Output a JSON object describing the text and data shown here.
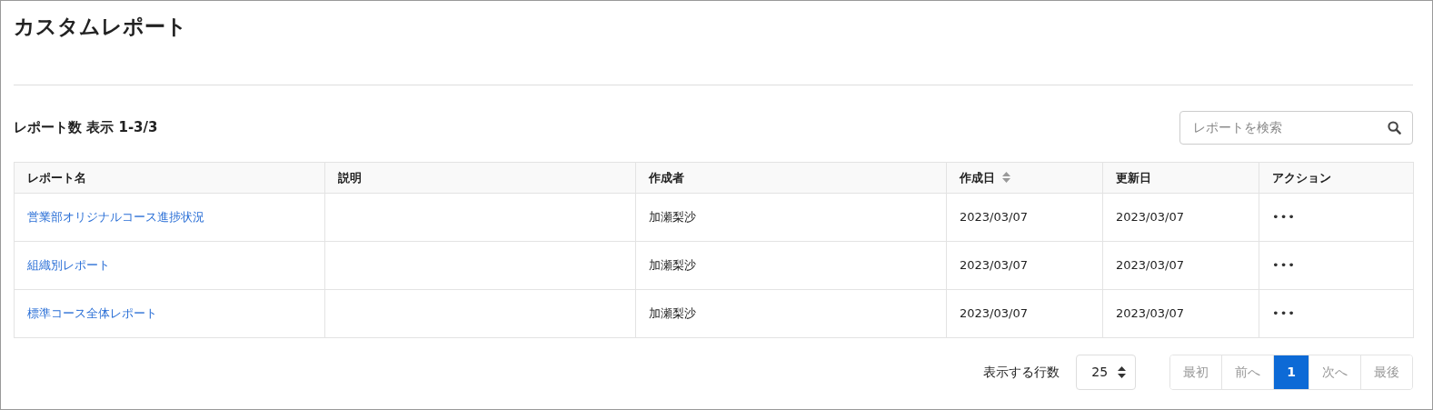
{
  "title": "カスタムレポート",
  "report_count": "レポート数 表示 1-3/3",
  "search": {
    "placeholder": "レポートを検索"
  },
  "table": {
    "columns": [
      {
        "label": "レポート名",
        "sortable": false
      },
      {
        "label": "説明",
        "sortable": false
      },
      {
        "label": "作成者",
        "sortable": false
      },
      {
        "label": "作成日",
        "sortable": true
      },
      {
        "label": "更新日",
        "sortable": false
      },
      {
        "label": "アクション",
        "sortable": false
      }
    ],
    "rows": [
      {
        "name": "営業部オリジナルコース進捗状況",
        "author": "加瀬梨沙",
        "created": "2023/03/07",
        "updated": "2023/03/07",
        "action": "•••"
      },
      {
        "name": "組織別レポート",
        "author": "加瀬梨沙",
        "created": "2023/03/07",
        "updated": "2023/03/07",
        "action": "•••"
      },
      {
        "name": "標準コース全体レポート",
        "author": "加瀬梨沙",
        "created": "2023/03/07",
        "updated": "2023/03/07",
        "action": "•••"
      }
    ]
  },
  "rows_per_page": {
    "label": "表示する行数",
    "value": "25"
  },
  "pagination": [
    {
      "label": "最初",
      "disabled": true,
      "selected": false
    },
    {
      "label": "前へ",
      "disabled": true,
      "selected": false
    },
    {
      "label": "1",
      "disabled": false,
      "selected": true
    },
    {
      "label": "次へ",
      "disabled": true,
      "selected": false
    },
    {
      "label": "最後",
      "disabled": true,
      "selected": false
    }
  ]
}
